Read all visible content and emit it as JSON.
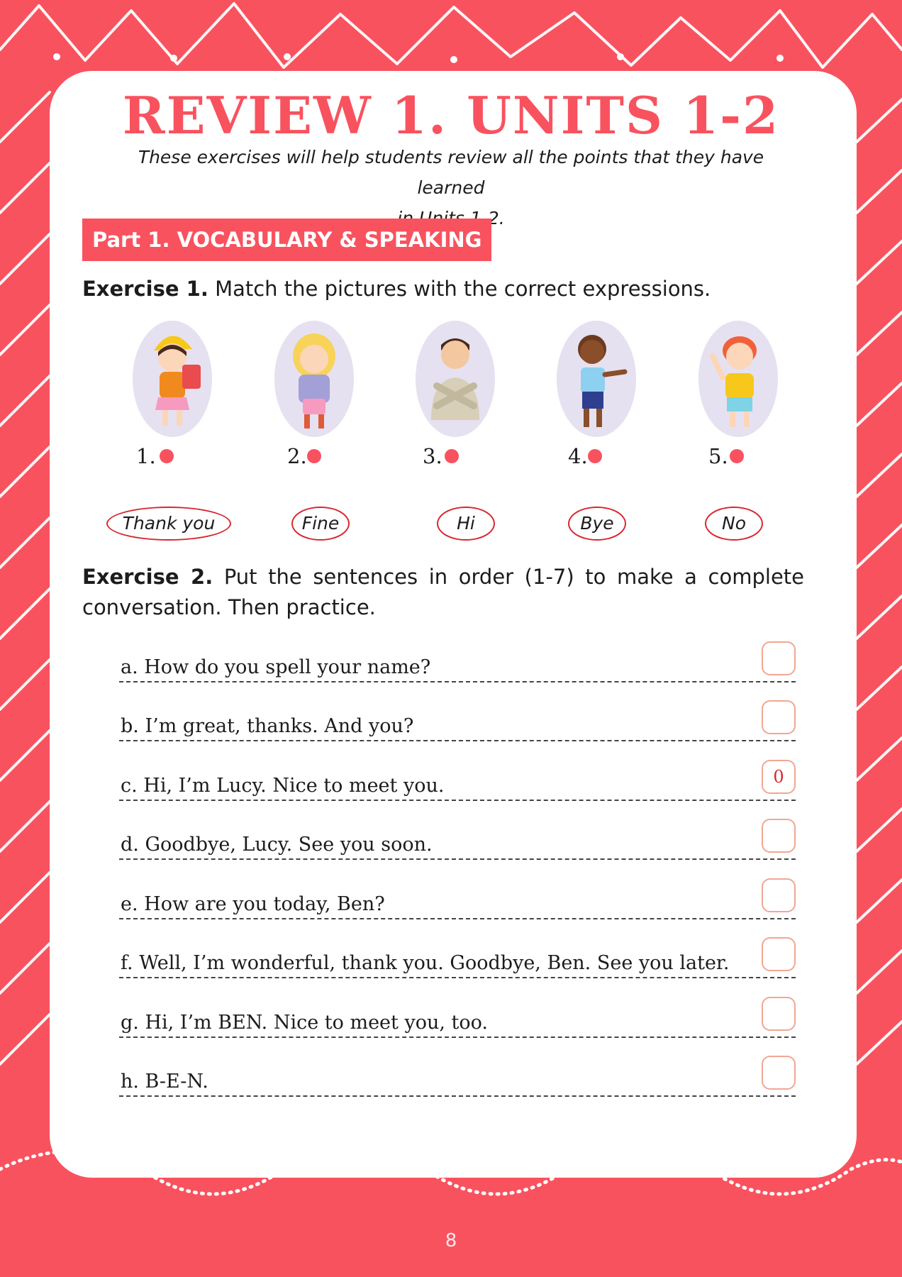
{
  "title": "REVIEW 1. UNITS 1-2",
  "subtitle_line1": "These exercises will help students review all the points that they have learned",
  "subtitle_line2": "in Units 1-2.",
  "part1": {
    "label": "Part 1. VOCABULARY & SPEAKING"
  },
  "exercise1": {
    "label": "Exercise 1.",
    "instruction": "Match the pictures with the correct expressions.",
    "pictures": [
      {
        "number": "1.",
        "icon": "girl-with-yellow-hat-icon"
      },
      {
        "number": "2.",
        "icon": "girl-with-blond-hair-icon"
      },
      {
        "number": "3.",
        "icon": "boy-crossed-arms-icon"
      },
      {
        "number": "4.",
        "icon": "boy-thumbs-up-icon"
      },
      {
        "number": "5.",
        "icon": "red-haired-boy-waving-icon"
      }
    ],
    "expressions": [
      "Thank you",
      "Fine",
      "Hi",
      "Bye",
      "No"
    ]
  },
  "exercise2": {
    "label": "Exercise 2.",
    "instruction": "Put the sentences in order (1-7) to make a complete conversation. Then practice.",
    "sentences": [
      {
        "text": "a. How do you spell your name?",
        "answer": ""
      },
      {
        "text": "b. I’m great, thanks. And you?",
        "answer": ""
      },
      {
        "text": "c. Hi, I’m Lucy. Nice to meet you.",
        "answer": "0"
      },
      {
        "text": "d. Goodbye, Lucy. See you soon.",
        "answer": ""
      },
      {
        "text": "e. How are you today, Ben?",
        "answer": ""
      },
      {
        "text": "f. Well, I’m wonderful, thank you. Goodbye, Ben. See you later.",
        "answer": ""
      },
      {
        "text": "g. Hi, I’m BEN. Nice to meet you, too.",
        "answer": ""
      },
      {
        "text": "h. B-E-N.",
        "answer": ""
      }
    ]
  },
  "page_number": "8",
  "colors": {
    "brand": "#f9525f",
    "answer": "#d8272f",
    "box_border": "#f0a793",
    "picture_bg": "#e6e1f0"
  }
}
